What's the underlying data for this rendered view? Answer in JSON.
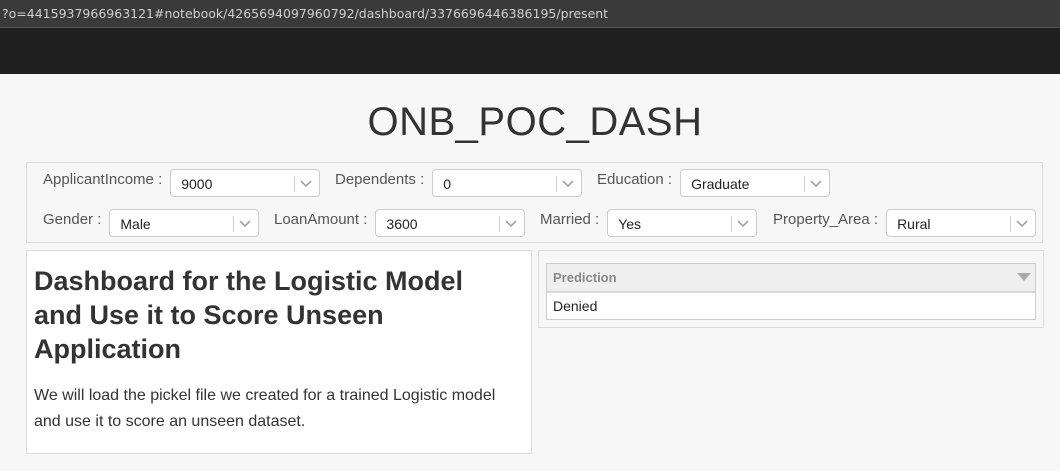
{
  "browser": {
    "url": "?o=4415937966963121#notebook/4265694097960792/dashboard/3376696446386195/present"
  },
  "dashboard": {
    "title": "ONB_POC_DASH"
  },
  "widgets": {
    "applicant_income": {
      "label": "ApplicantIncome :",
      "value": "9000"
    },
    "dependents": {
      "label": "Dependents :",
      "value": "0"
    },
    "education": {
      "label": "Education :",
      "value": "Graduate"
    },
    "gender": {
      "label": "Gender :",
      "value": "Male"
    },
    "loan_amount": {
      "label": "LoanAmount :",
      "value": "3600"
    },
    "married": {
      "label": "Married :",
      "value": "Yes"
    },
    "property_area": {
      "label": "Property_Area :",
      "value": "Rural"
    }
  },
  "markdown": {
    "heading": "Dashboard for the Logistic Model and Use it to Score Unseen Application",
    "body": "We will load the pickel file we created for a trained Logistic model and use it to score an unseen dataset."
  },
  "results": {
    "columns": [
      "Prediction"
    ],
    "rows": [
      [
        "Denied"
      ]
    ]
  },
  "colors": {
    "top_bar": "#1f1f1f",
    "url_bar": "#3a3a3a",
    "page_bg": "#f7f7f7"
  },
  "icons": {
    "dropdown": "chevron-down-icon",
    "sort": "sort-caret-icon"
  }
}
